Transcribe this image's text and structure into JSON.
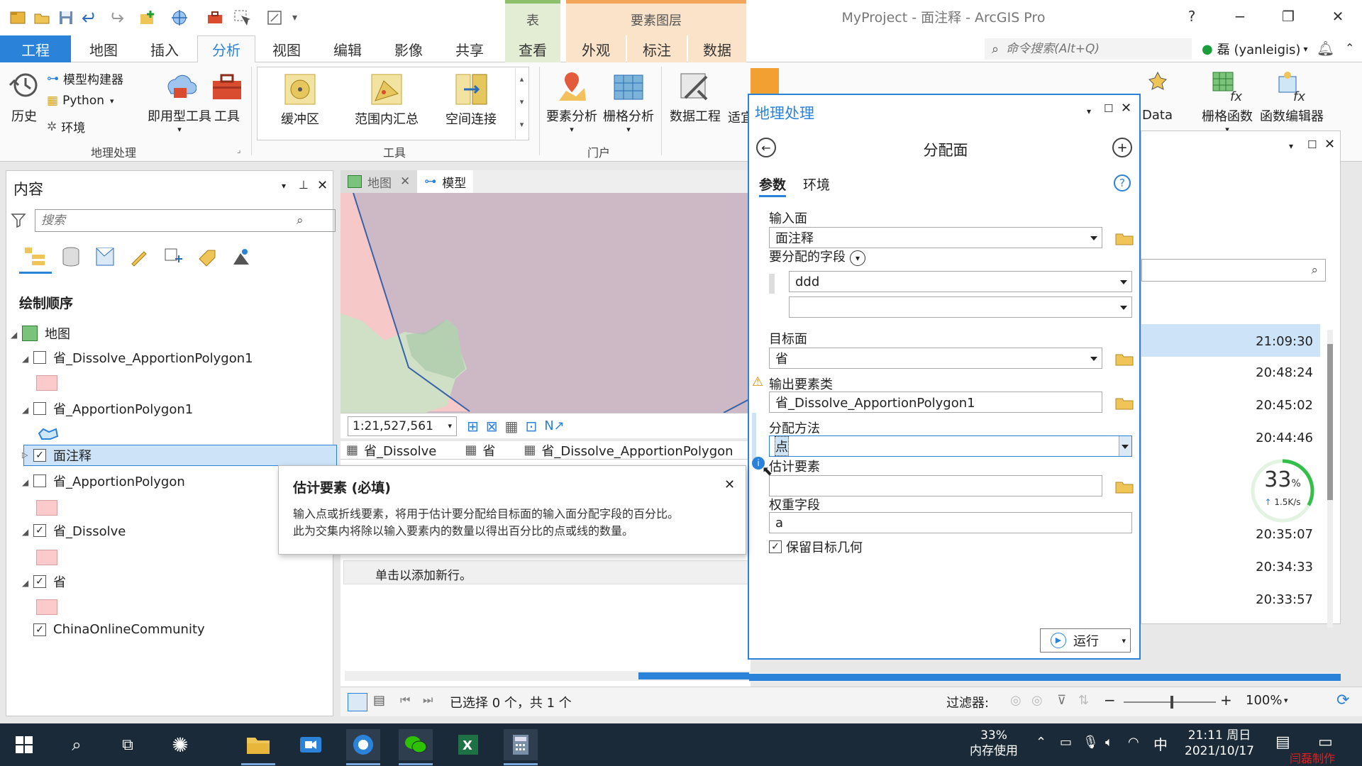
{
  "title": {
    "window_title": "MyProject - 面注释 - ArcGIS Pro",
    "context_table": "表",
    "context_layer": "要素图层",
    "help": "?",
    "minimize": "−",
    "restore": "❐",
    "close": "✕"
  },
  "tabs": {
    "project": "工程",
    "map": "地图",
    "insert": "插入",
    "analysis": "分析",
    "view": "视图",
    "edit": "编辑",
    "imagery": "影像",
    "share": "共享",
    "ctx_view": "查看",
    "appearance": "外观",
    "labeling": "标注",
    "data": "数据"
  },
  "command_search": {
    "placeholder": "命令搜索(Alt+Q)"
  },
  "user": {
    "name": "磊 (yanleigis)"
  },
  "ribbon": {
    "history": "历史",
    "modelbuilder": "模型构建器",
    "python": "Python",
    "environments": "环境",
    "ready_tools": "即用型工具",
    "tools": "工具",
    "group_geoprocessing": "地理处理",
    "buffer": "缓冲区",
    "summarize_within": "范围内汇总",
    "spatial_join": "空间连接",
    "group_tools": "工具",
    "feature_analysis": "要素分析",
    "raster_analysis": "栅格分析",
    "group_portal": "门户",
    "data_engineering": "数据工程",
    "suitability": "适宜",
    "data_short": "Data",
    "raster_function": "栅格函数",
    "function_editor": "函数编辑器"
  },
  "contents": {
    "title": "内容",
    "search_placeholder": "搜索",
    "drawing_order": "绘制顺序",
    "layers": [
      {
        "name": "地图",
        "checked": false
      },
      {
        "name": "省_Dissolve_ApportionPolygon1",
        "checked": false
      },
      {
        "name": "省_ApportionPolygon1",
        "checked": false
      },
      {
        "name": "面注释",
        "checked": true
      },
      {
        "name": "省_ApportionPolygon",
        "checked": false
      },
      {
        "name": "省_Dissolve",
        "checked": true
      },
      {
        "name": "省",
        "checked": true
      },
      {
        "name": "ChinaOnlineCommunity",
        "checked": true
      }
    ],
    "check_mark": "✓"
  },
  "view_tabs": {
    "map": "地图",
    "model": "模型"
  },
  "map": {
    "scale": "1:21,527,561"
  },
  "table_tabs": {
    "t1": "省_Dissolve",
    "t2": "省",
    "t3": "省_Dissolve_ApportionPolygon"
  },
  "table": {
    "add_row": "单击以添加新行。"
  },
  "tooltip": {
    "title": "估计要素 (必填)",
    "body_line1": "输入点或折线要素，将用于估计要分配给目标面的输入面分配字段的百分比。",
    "body_line2": "此为交集内将除以输入要素内的数量以得出百分比的点或线的数量。",
    "close": "✕"
  },
  "gp": {
    "title": "地理处理",
    "tool_name": "分配面",
    "tab_params": "参数",
    "tab_env": "环境",
    "input_polygons_label": "输入面",
    "input_polygons_value": "面注释",
    "fields_label": "要分配的字段",
    "field1_value": "ddd",
    "field2_value": "",
    "target_label": "目标面",
    "target_value": "省",
    "output_label": "输出要素类",
    "output_value": "省_Dissolve_ApportionPolygon1",
    "method_label": "分配方法",
    "method_value": "点",
    "estimation_label": "估计要素",
    "estimation_value": "",
    "weight_label": "权重字段",
    "weight_value": "a",
    "keep_geometry_label": "保留目标几何",
    "keep_geometry_checked": true,
    "run": "运行"
  },
  "history": {
    "times": [
      "21:09:30",
      "20:48:24",
      "20:45:02",
      "20:44:46",
      "20:35:07",
      "20:34:33",
      "20:33:57"
    ],
    "progress_percent": "33",
    "progress_unit": "%",
    "progress_rate": "1.5K/s"
  },
  "status": {
    "selection": "已选择 0 个，共 1 个",
    "filter": "过滤器:",
    "zoom": "100%"
  },
  "taskbar": {
    "mem_percent": "33%",
    "mem_label": "内存使用",
    "ime": "中",
    "time": "21:11 周日",
    "date": "2021/10/17",
    "watermark": "闫磊制作"
  },
  "colors": {
    "accent": "#2b82d9",
    "selected_row": "#cde3f7"
  }
}
